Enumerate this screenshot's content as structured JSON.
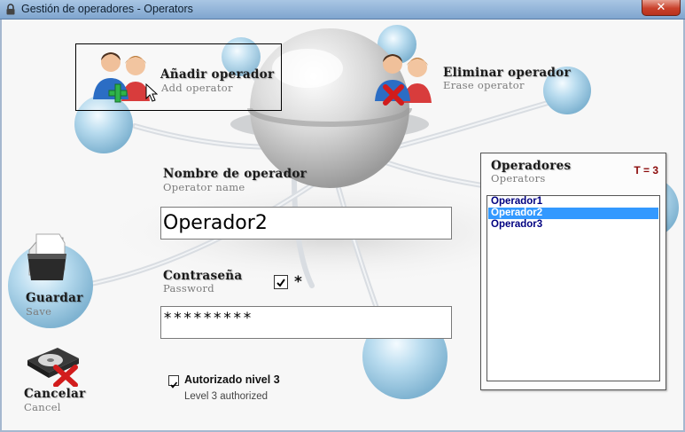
{
  "window": {
    "title": "Gestión de operadores - Operators",
    "close_glyph": "✕",
    "lock_icon": "lock-icon"
  },
  "actions": {
    "add": {
      "label": "Añadir operador",
      "sub": "Add operator",
      "icon": "add-operator-icon"
    },
    "erase": {
      "label": "Eliminar operador",
      "sub": "Erase operator",
      "icon": "erase-operator-icon"
    },
    "save": {
      "label": "Guardar",
      "sub": "Save",
      "icon": "save-folder-icon"
    },
    "cancel": {
      "label": "Cancelar",
      "sub": "Cancel",
      "icon": "cancel-disk-icon"
    }
  },
  "form": {
    "name": {
      "label": "Nombre de operador",
      "sub": "Operator name",
      "value": "Operador2"
    },
    "password": {
      "label": "Contraseña",
      "sub": "Password",
      "value": "*********",
      "show_checked": true,
      "star": "*"
    },
    "authorized": {
      "label": "Autorizado nivel 3",
      "sub": "Level 3 authorized",
      "checked": true
    }
  },
  "operators": {
    "title": "Operadores",
    "sub": "Operators",
    "count": "T = 3",
    "items": [
      "Operador1",
      "Operador2",
      "Operador3"
    ],
    "selected": 1
  },
  "colors": {
    "selection": "#3399ff",
    "list_text": "#000080",
    "count_text": "#8b0a0a",
    "add_plus": "#2fb34a",
    "erase_x": "#d21c1c"
  }
}
